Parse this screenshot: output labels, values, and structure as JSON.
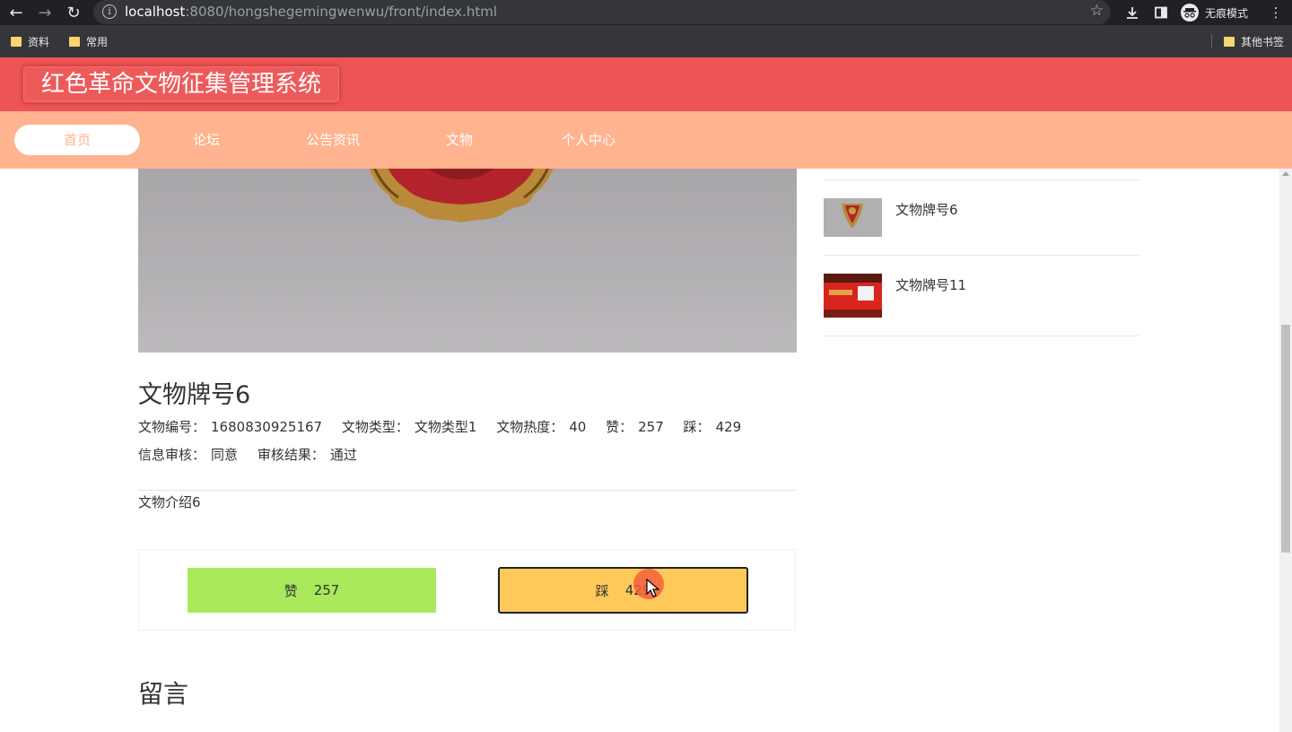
{
  "browser": {
    "url_host": "localhost",
    "url_rest": ":8080/hongshegemingwenwu/front/index.html",
    "incognito_label": "无痕模式",
    "bookmarks": [
      "资料",
      "常用"
    ],
    "other_bookmarks": "其他书签"
  },
  "site": {
    "title": "红色革命文物征集管理系统",
    "nav": [
      "首页",
      "论坛",
      "公告资讯",
      "文物",
      "个人中心"
    ],
    "active_nav": "首页"
  },
  "detail": {
    "name": "文物牌号6",
    "code_label": "文物编号：",
    "code": "1680830925167",
    "type_label": "文物类型：",
    "type": "文物类型1",
    "heat_label": "文物热度：",
    "heat": "40",
    "like_label": "赞：",
    "like": "257",
    "dislike_label": "踩：",
    "dislike": "429",
    "audit_label": "信息审核：",
    "audit": "同意",
    "result_label": "审核结果：",
    "result": "通过",
    "intro": "文物介绍6"
  },
  "votes": {
    "like_label": "赞",
    "like_count": "257",
    "dislike_label": "踩",
    "dislike_count": "429"
  },
  "comments_title": "留言",
  "sidebar": {
    "items": [
      {
        "label": "文物牌号6"
      },
      {
        "label": "文物牌号11"
      }
    ]
  },
  "colors": {
    "header": "#ec5456",
    "nav_bar": "#ffb38f",
    "like_button": "#a9e95b",
    "dislike_button": "#ffc95a"
  }
}
